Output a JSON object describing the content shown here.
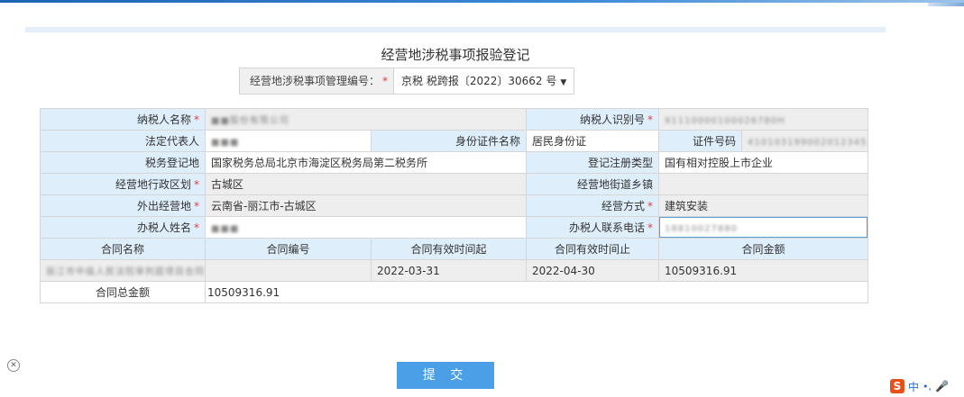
{
  "form": {
    "title": "经营地涉税事项报验登记",
    "code_label": "经营地涉税事项管理编号：",
    "required_mark": "*",
    "code_value": "京税 税跨报〔2022〕30662 号"
  },
  "rows": {
    "taxpayer_name_label": "纳税人名称",
    "taxpayer_name_value": "■■股份有限公司",
    "taxpayer_id_label": "纳税人识别号",
    "taxpayer_id_value": "91110000100026780H",
    "legal_rep_label": "法定代表人",
    "legal_rep_value": "■■■",
    "id_type_label": "身份证件名称",
    "id_type_value": "居民身份证",
    "id_no_label": "证件号码",
    "id_no_value": "410103199002012345",
    "tax_reg_label": "税务登记地",
    "tax_reg_value": "国家税务总局北京市海淀区税务局第二税务所",
    "reg_type_label": "登记注册类型",
    "reg_type_value": "国有相对控股上市企业",
    "district_label": "经营地行政区划",
    "district_value": "古城区",
    "street_label": "经营地街道乡镇",
    "street_value": "",
    "out_place_label": "外出经营地",
    "out_place_value": "云南省-丽江市-古城区",
    "method_label": "经营方式",
    "method_value": "建筑安装",
    "handler_label": "办税人姓名",
    "handler_value": "■■■",
    "phone_label": "办税人联系电话",
    "phone_value": "18810027880"
  },
  "contracts": {
    "headers": [
      "合同名称",
      "合同编号",
      "合同有效时间起",
      "合同有效时间止",
      "合同金额"
    ],
    "row": {
      "name": "丽江市中级人民法院审判庭项目合同",
      "number": "",
      "start": "2022-03-31",
      "end": "2022-04-30",
      "amount": "10509316.91"
    },
    "total_label": "合同总金额",
    "total_value": "10509316.91"
  },
  "actions": {
    "submit_label": "提 交"
  },
  "ime": {
    "logo": "S",
    "mode": "中",
    "punct": "•,",
    "mic": "🎤"
  }
}
